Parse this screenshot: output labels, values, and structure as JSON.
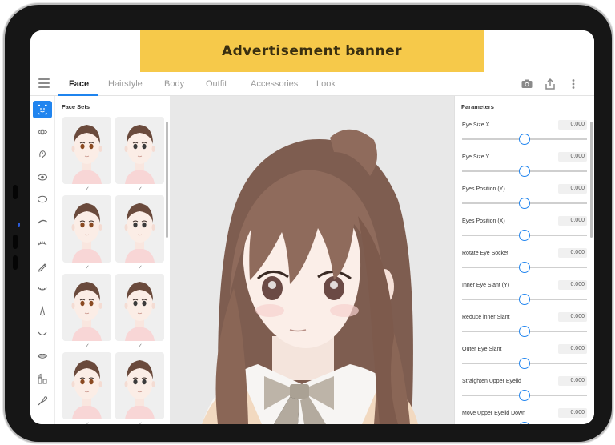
{
  "ad": {
    "text": "Advertisement banner"
  },
  "tabs": [
    {
      "label": "Face",
      "active": true
    },
    {
      "label": "Hairstyle"
    },
    {
      "label": "Body"
    },
    {
      "label": "Outfit"
    },
    {
      "label": "Accessories"
    },
    {
      "label": "Look"
    }
  ],
  "toolbar_icons": [
    "camera-icon",
    "share-icon",
    "more-vertical-icon"
  ],
  "rail_icons": [
    "face-sets-icon",
    "eye-icon",
    "ear-icon",
    "eye-shape-icon",
    "face-outline-icon",
    "eyebrow-icon",
    "eyelash-icon",
    "pen-icon",
    "lower-lash-icon",
    "nose-icon",
    "mouth-icon",
    "lips-icon",
    "makeup-icon",
    "brush-icon"
  ],
  "face_sets": {
    "title": "Face Sets",
    "items": [
      {
        "eye": "#8a4a22",
        "selected": true
      },
      {
        "eye": "#3b3b3b",
        "selected": true
      },
      {
        "eye": "#8a4a22",
        "selected": true
      },
      {
        "eye": "#3b3b3b",
        "selected": true
      },
      {
        "eye": "#8a4a22",
        "selected": true
      },
      {
        "eye": "#3b3b3b",
        "selected": true
      },
      {
        "eye": "#8a4a22",
        "selected": true
      },
      {
        "eye": "#3b3b3b",
        "selected": true
      }
    ],
    "check_glyph": "✓"
  },
  "parameters": {
    "title": "Parameters",
    "items": [
      {
        "label": "Eye Size X",
        "value": "0.000",
        "level": 0.5
      },
      {
        "label": "Eye Size Y",
        "value": "0.000",
        "level": 0.5
      },
      {
        "label": "Eyes Position (Y)",
        "value": "0.000",
        "level": 0.5
      },
      {
        "label": "Eyes Position (X)",
        "value": "0.000",
        "level": 0.5
      },
      {
        "label": "Rotate Eye Socket",
        "value": "0.000",
        "level": 0.5
      },
      {
        "label": "Inner Eye Slant (Y)",
        "value": "0.000",
        "level": 0.5
      },
      {
        "label": "Reduce inner Slant",
        "value": "0.000",
        "level": 0.5
      },
      {
        "label": "Outer Eye Slant",
        "value": "0.000",
        "level": 0.5
      },
      {
        "label": "Straighten Upper Eyelid",
        "value": "0.000",
        "level": 0.5
      },
      {
        "label": "Move Upper Eyelid Down",
        "value": "0.000",
        "level": 0.5
      }
    ]
  },
  "colors": {
    "accent": "#2185ef",
    "ad_bg": "#f6c94a",
    "hair": "#8f6b5c"
  }
}
